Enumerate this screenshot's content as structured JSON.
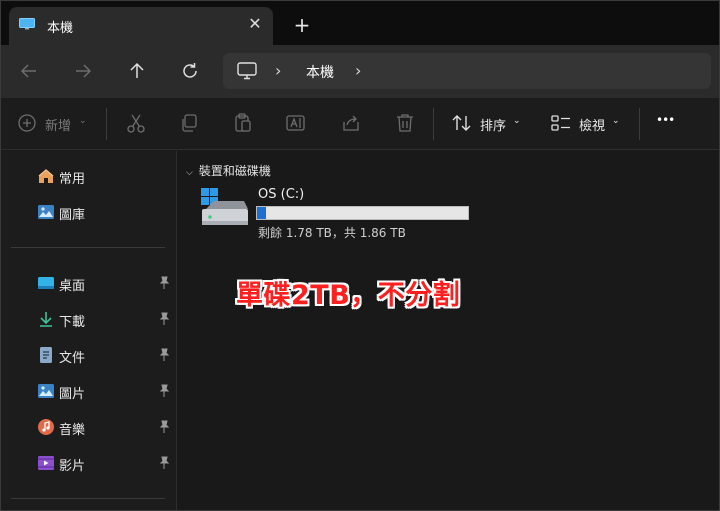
{
  "tab": {
    "title": "本機",
    "close_glyph": "✕",
    "new_tab_glyph": "+"
  },
  "nav": {
    "back_icon": "arrow-left-icon",
    "forward_icon": "arrow-right-icon",
    "up_icon": "arrow-up-icon",
    "refresh_icon": "refresh-icon"
  },
  "address": {
    "root_icon": "computer-icon",
    "chevron": "›",
    "location": "本機"
  },
  "toolbar": {
    "new_label": "新增",
    "sort_label": "排序",
    "view_label": "檢視",
    "more_glyph": "•••",
    "caret": "⌄"
  },
  "sidebar": {
    "top_items": [
      {
        "label": "常用",
        "icon": "home-icon"
      },
      {
        "label": "圖庫",
        "icon": "gallery-icon"
      }
    ],
    "pinned_items": [
      {
        "label": "桌面",
        "icon": "desktop-icon"
      },
      {
        "label": "下載",
        "icon": "download-icon"
      },
      {
        "label": "文件",
        "icon": "document-icon"
      },
      {
        "label": "圖片",
        "icon": "pictures-icon"
      },
      {
        "label": "音樂",
        "icon": "music-icon"
      },
      {
        "label": "影片",
        "icon": "video-icon"
      }
    ]
  },
  "main": {
    "group_chevron": "⌵",
    "group_title": "裝置和磁碟機",
    "drive": {
      "name": "OS (C:)",
      "space_text": "剩餘 1.78 TB，共 1.86 TB",
      "free_tb": 1.78,
      "total_tb": 1.86
    },
    "annotation": "單碟2TB，不分割"
  },
  "colors": {
    "accent": "#1e6fd0",
    "annotation_red": "#ff1f1f",
    "background": "#191919"
  }
}
